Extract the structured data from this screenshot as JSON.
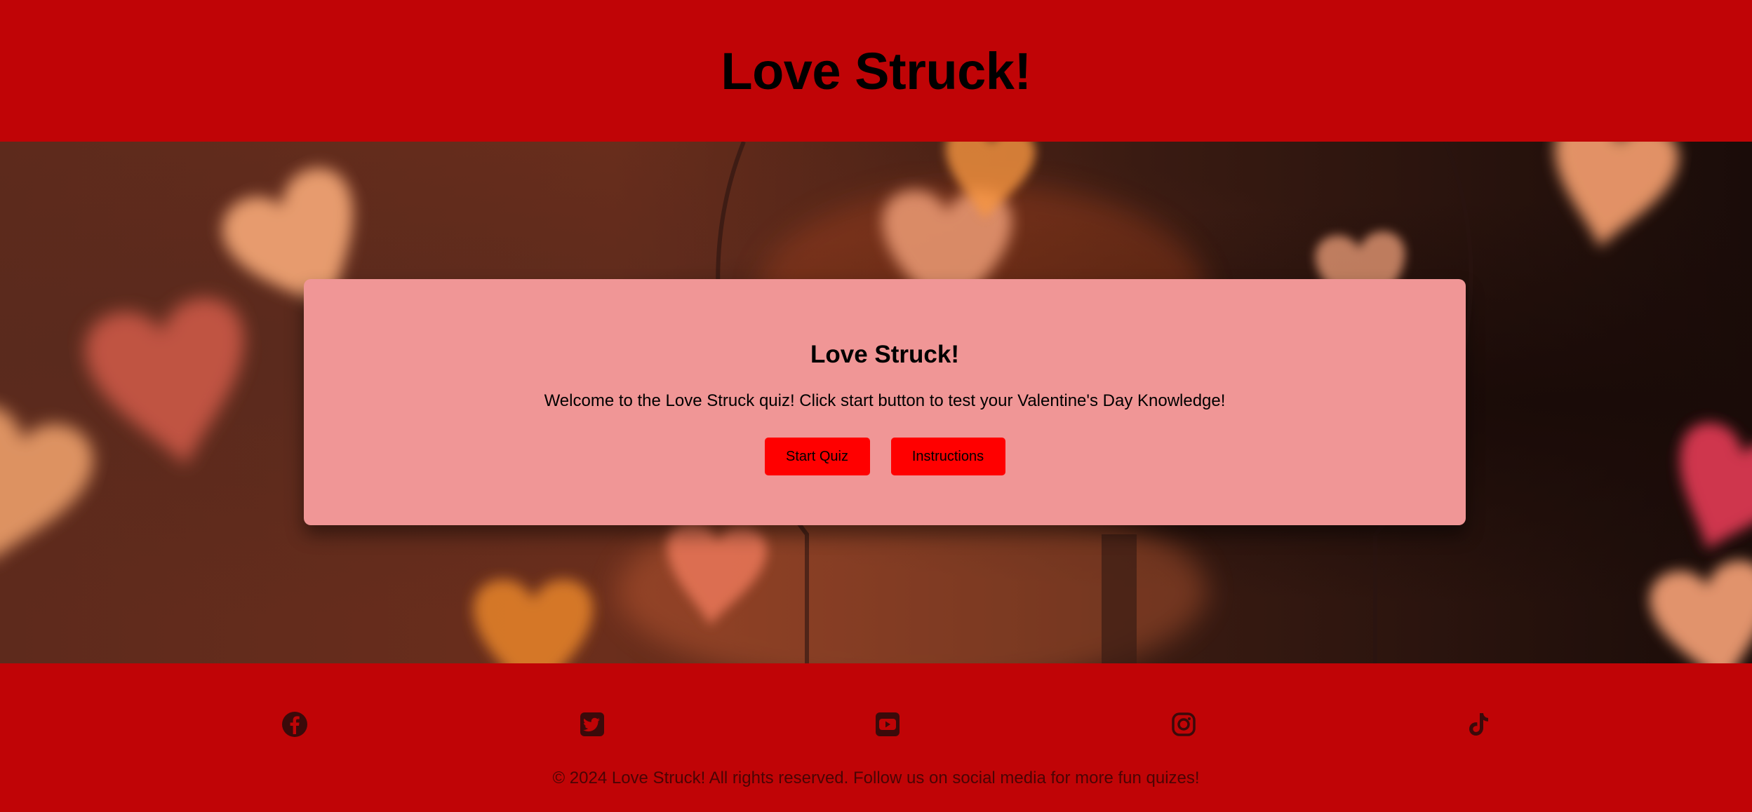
{
  "header": {
    "title": "Love Struck!"
  },
  "card": {
    "title": "Love Struck!",
    "welcome_text": "Welcome to the Love Struck quiz! Click start button to test your Valentine's Day Knowledge!",
    "start_button_label": "Start Quiz",
    "instructions_button_label": "Instructions"
  },
  "footer": {
    "social_icons": [
      "facebook-icon",
      "twitter-icon",
      "youtube-icon",
      "instagram-icon",
      "tiktok-icon"
    ],
    "copyright": "© 2024 Love Struck! All rights reserved. Follow us on social media for more fun quizes!"
  },
  "colors": {
    "header_bg": "#c00406",
    "card_bg": "#f09696",
    "button_bg": "#ff0000",
    "footer_text": "#4a0404"
  }
}
